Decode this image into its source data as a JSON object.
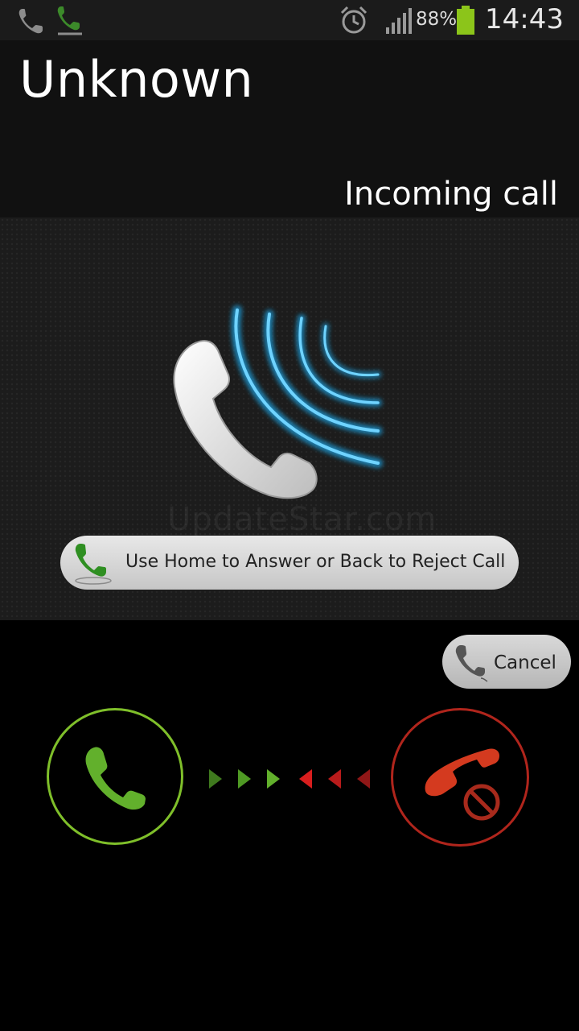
{
  "status_bar": {
    "icons": [
      "phone-icon",
      "missed-call-icon",
      "alarm-icon",
      "signal-icon",
      "battery-icon"
    ],
    "battery": "88%",
    "time": "14:43"
  },
  "caller": {
    "name": "Unknown",
    "status": "Incoming call"
  },
  "watermark": "UpdateStar.com",
  "hint": {
    "text": "Use Home to Answer or Back to Reject Call",
    "icon": "phone-hint-icon"
  },
  "cancel_button": {
    "label": "Cancel",
    "icon": "phone-icon"
  },
  "controls": {
    "answer_icon": "answer-phone-icon",
    "reject_icon": "reject-phone-icon",
    "answer_color": "#7fbf2a",
    "reject_color": "#d43a1f"
  }
}
